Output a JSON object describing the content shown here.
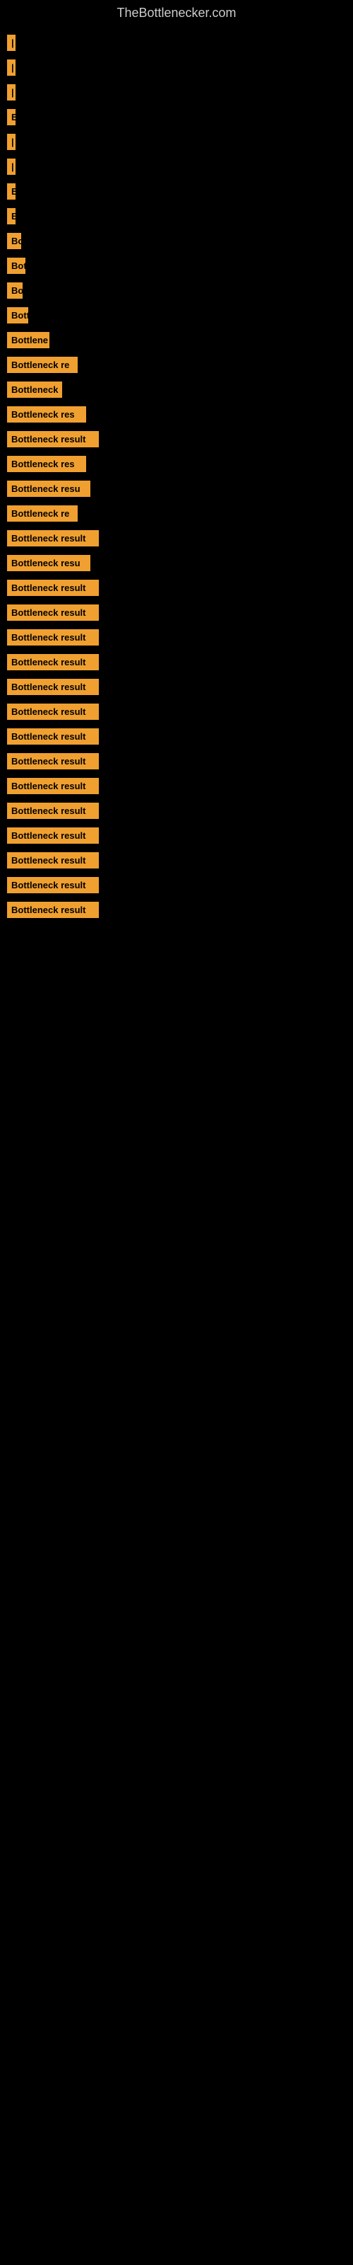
{
  "header": {
    "title": "TheBottlenecker.com"
  },
  "items": [
    {
      "id": 1,
      "label": "|",
      "width": 6
    },
    {
      "id": 2,
      "label": "|",
      "width": 6
    },
    {
      "id": 3,
      "label": "|",
      "width": 6
    },
    {
      "id": 4,
      "label": "E",
      "width": 10
    },
    {
      "id": 5,
      "label": "|",
      "width": 6
    },
    {
      "id": 6,
      "label": "|",
      "width": 6
    },
    {
      "id": 7,
      "label": "E",
      "width": 10
    },
    {
      "id": 8,
      "label": "B",
      "width": 12
    },
    {
      "id": 9,
      "label": "Bo",
      "width": 20
    },
    {
      "id": 10,
      "label": "Bot",
      "width": 26
    },
    {
      "id": 11,
      "label": "Bo",
      "width": 22
    },
    {
      "id": 12,
      "label": "Bott",
      "width": 30
    },
    {
      "id": 13,
      "label": "Bottlene",
      "width": 60
    },
    {
      "id": 14,
      "label": "Bottleneck re",
      "width": 100
    },
    {
      "id": 15,
      "label": "Bottleneck",
      "width": 78
    },
    {
      "id": 16,
      "label": "Bottleneck res",
      "width": 112
    },
    {
      "id": 17,
      "label": "Bottleneck result",
      "width": 130
    },
    {
      "id": 18,
      "label": "Bottleneck res",
      "width": 112
    },
    {
      "id": 19,
      "label": "Bottleneck resu",
      "width": 118
    },
    {
      "id": 20,
      "label": "Bottleneck re",
      "width": 100
    },
    {
      "id": 21,
      "label": "Bottleneck result",
      "width": 130
    },
    {
      "id": 22,
      "label": "Bottleneck resu",
      "width": 118
    },
    {
      "id": 23,
      "label": "Bottleneck result",
      "width": 130
    },
    {
      "id": 24,
      "label": "Bottleneck result",
      "width": 130
    },
    {
      "id": 25,
      "label": "Bottleneck result",
      "width": 130
    },
    {
      "id": 26,
      "label": "Bottleneck result",
      "width": 130
    },
    {
      "id": 27,
      "label": "Bottleneck result",
      "width": 130
    },
    {
      "id": 28,
      "label": "Bottleneck result",
      "width": 130
    },
    {
      "id": 29,
      "label": "Bottleneck result",
      "width": 130
    },
    {
      "id": 30,
      "label": "Bottleneck result",
      "width": 130
    },
    {
      "id": 31,
      "label": "Bottleneck result",
      "width": 130
    },
    {
      "id": 32,
      "label": "Bottleneck result",
      "width": 130
    },
    {
      "id": 33,
      "label": "Bottleneck result",
      "width": 130
    },
    {
      "id": 34,
      "label": "Bottleneck result",
      "width": 130
    },
    {
      "id": 35,
      "label": "Bottleneck result",
      "width": 130
    },
    {
      "id": 36,
      "label": "Bottleneck result",
      "width": 130
    }
  ]
}
